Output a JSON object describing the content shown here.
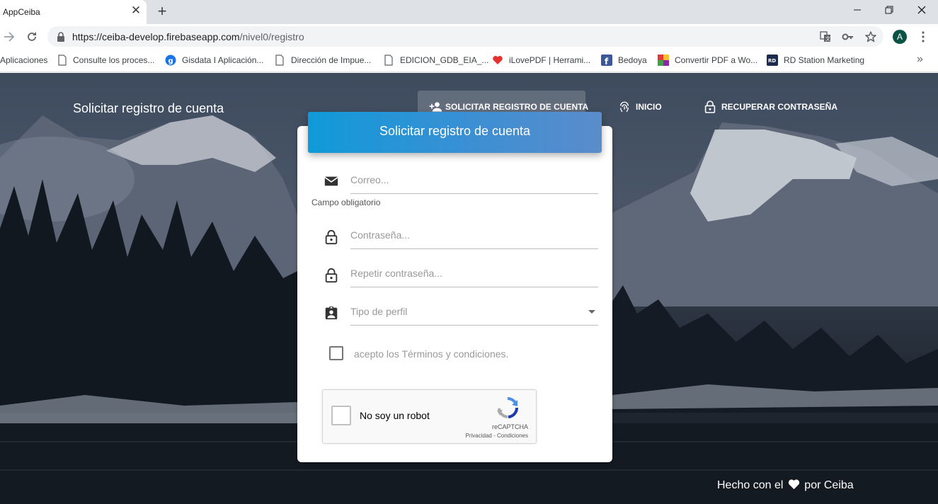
{
  "browser": {
    "tab_title": "AppCeiba",
    "tab_close": "✕",
    "new_tab": "+",
    "url_host": "https://ceiba-develop.firebaseapp.com",
    "url_path": "/nivel0/registro",
    "avatar_letter": "A",
    "bookmarks": [
      "Aplicaciones",
      "Consulte los proces...",
      "Gisdata I Aplicación...",
      "Dirección de Impue...",
      "EDICION_GDB_EIA_...",
      "iLovePDF | Herrami...",
      "Bedoya",
      "Convertir PDF a Wo...",
      "RD Station Marketing"
    ],
    "bookmarks_more": "»"
  },
  "header": {
    "brand": "Solicitar registro de cuenta",
    "nav": [
      {
        "label": "SOLICITAR REGISTRO DE CUENTA",
        "icon": "person-add-icon",
        "active": true
      },
      {
        "label": "INICIO",
        "icon": "fingerprint-icon",
        "active": false
      },
      {
        "label": "RECUPERAR CONTRASEÑA",
        "icon": "lock-open-icon",
        "active": false
      }
    ]
  },
  "form": {
    "title": "Solicitar registro de cuenta",
    "email_placeholder": "Correo...",
    "email_hint": "Campo obligatorio",
    "password_placeholder": "Contraseña...",
    "repeat_password_placeholder": "Repetir contraseña...",
    "profile_type_label": "Tipo de perfil",
    "terms_label": "acepto los Términos y condiciones.",
    "terms_checked": false,
    "accent_color": "#109ad9"
  },
  "recaptcha": {
    "label": "No soy un robot",
    "brand": "reCAPTCHA",
    "links": "Privacidad - Condiciones"
  },
  "footer": {
    "prefix": "Hecho con el",
    "suffix": "por Ceiba"
  }
}
